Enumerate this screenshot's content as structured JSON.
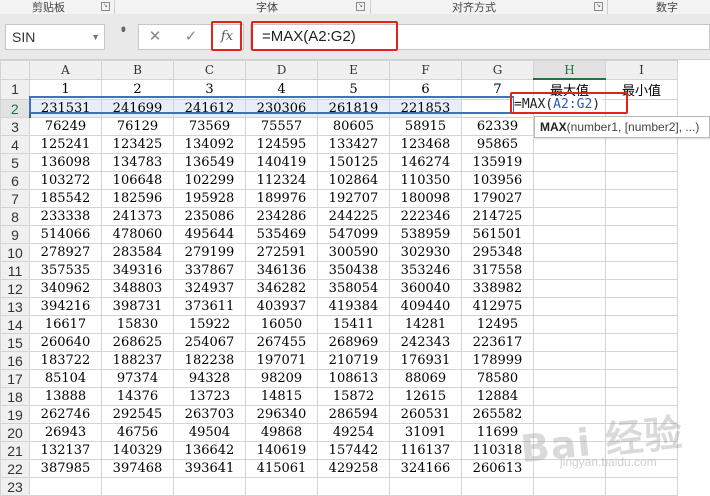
{
  "ribbon": {
    "groups": [
      "剪贴板",
      "字体",
      "对齐方式",
      "数字"
    ]
  },
  "formula_bar": {
    "name_box": "SIN",
    "cancel_glyph": "✕",
    "enter_glyph": "✓",
    "fx_label": "fx",
    "content": "=MAX(A2:G2)"
  },
  "sheet": {
    "columns": [
      "A",
      "B",
      "C",
      "D",
      "E",
      "F",
      "G",
      "H",
      "I"
    ],
    "selected_column": "H",
    "selected_row": 2,
    "header_row": [
      "1",
      "2",
      "3",
      "4",
      "5",
      "6",
      "7",
      "最大值",
      "最小值"
    ],
    "rows": [
      [
        "231531",
        "241699",
        "241612",
        "230306",
        "261819",
        "221853",
        ""
      ],
      [
        "76249",
        "76129",
        "73569",
        "75557",
        "80605",
        "58915",
        "62339"
      ],
      [
        "125241",
        "123425",
        "134092",
        "124595",
        "133427",
        "123468",
        "95865"
      ],
      [
        "136098",
        "134783",
        "136549",
        "140419",
        "150125",
        "146274",
        "135919"
      ],
      [
        "103272",
        "106648",
        "102299",
        "112324",
        "102864",
        "110350",
        "103956"
      ],
      [
        "185542",
        "182596",
        "195928",
        "189976",
        "192707",
        "180098",
        "179027"
      ],
      [
        "233338",
        "241373",
        "235086",
        "234286",
        "244225",
        "222346",
        "214725"
      ],
      [
        "514066",
        "478060",
        "495644",
        "535469",
        "547099",
        "538959",
        "561501"
      ],
      [
        "278927",
        "283584",
        "279199",
        "272591",
        "300590",
        "302930",
        "295348"
      ],
      [
        "357535",
        "349316",
        "337867",
        "346136",
        "350438",
        "353246",
        "317558"
      ],
      [
        "340962",
        "348803",
        "324937",
        "346282",
        "358054",
        "360040",
        "338982"
      ],
      [
        "394216",
        "398731",
        "373611",
        "403937",
        "419384",
        "409440",
        "412975"
      ],
      [
        "16617",
        "15830",
        "15922",
        "16050",
        "15411",
        "14281",
        "12495"
      ],
      [
        "260640",
        "268625",
        "254067",
        "267455",
        "268969",
        "242343",
        "223617"
      ],
      [
        "183722",
        "188237",
        "182238",
        "197071",
        "210719",
        "176931",
        "178999"
      ],
      [
        "85104",
        "97374",
        "94328",
        "98209",
        "108613",
        "88069",
        "78580"
      ],
      [
        "13888",
        "14376",
        "13723",
        "14815",
        "15872",
        "12615",
        "12884"
      ],
      [
        "262746",
        "292545",
        "263703",
        "296340",
        "286594",
        "260531",
        "265582"
      ],
      [
        "26943",
        "46756",
        "49504",
        "49868",
        "49254",
        "31091",
        "11699"
      ],
      [
        "132137",
        "140329",
        "136642",
        "140619",
        "157442",
        "116137",
        "110318"
      ],
      [
        "387985",
        "397468",
        "393641",
        "415061",
        "429258",
        "324166",
        "260613"
      ]
    ],
    "editing_cell": {
      "prefix": "=MAX(",
      "ref": "A2:G2",
      "suffix": ")"
    },
    "tooltip": {
      "func": "MAX",
      "args": "(number1, [number2], ...)"
    }
  },
  "watermark": {
    "text": "Bai 经验",
    "sub": "jingyan.baidu.com"
  },
  "colors": {
    "highlight_red": "#e0241b",
    "range_blue": "#3f70c2",
    "selected_header_green": "#217346"
  }
}
